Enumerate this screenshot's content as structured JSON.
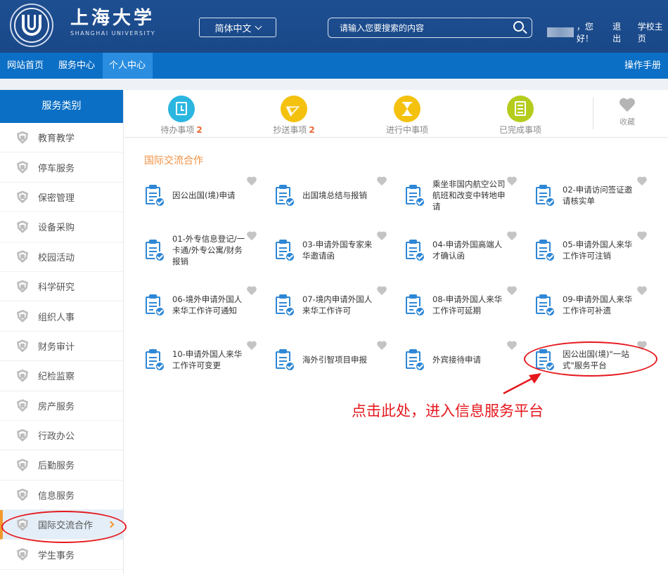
{
  "header": {
    "logo_cn": "上海大学",
    "logo_en": "SHANGHAI UNIVERSITY",
    "language": "简体中文",
    "search_placeholder": "请输入您要搜索的内容",
    "greeting": "，您好！",
    "logout": "退出",
    "school_home": "学校主页"
  },
  "nav": {
    "items": [
      "网站首页",
      "服务中心",
      "个人中心"
    ],
    "active": "个人中心",
    "manual": "操作手册"
  },
  "sidebar": {
    "title": "服务类别",
    "items": [
      "教育教学",
      "停车服务",
      "保密管理",
      "设备采购",
      "校园活动",
      "科学研究",
      "组织人事",
      "财务审计",
      "纪检监察",
      "房产服务",
      "行政办公",
      "后勤服务",
      "信息服务",
      "国际交流合作",
      "学生事务"
    ],
    "active": "国际交流合作"
  },
  "tabs": [
    {
      "label": "待办事项",
      "count": "2",
      "icon": "clock-calendar-icon",
      "color": "#2bb6e0"
    },
    {
      "label": "抄送事项",
      "count": "2",
      "icon": "paper-plane-icon",
      "color": "#f4c10f"
    },
    {
      "label": "进行中事项",
      "count": "",
      "icon": "hourglass-icon",
      "color": "#f4c10f"
    },
    {
      "label": "已完成事项",
      "count": "",
      "icon": "checklist-icon",
      "color": "#b6cc1d"
    }
  ],
  "favorites_label": "收藏",
  "section_title": "国际交流合作",
  "services": [
    "因公出国(境)申请",
    "出国境总结与报销",
    "乘坐非国内航空公司航班和改变中转地申请",
    "02-申请访问签证邀请核实单",
    "01-外专信息登记/一卡通/外专公寓/财务报销",
    "03-申请外国专家来华邀请函",
    "04-申请外国高端人才确认函",
    "05-申请外国人来华工作许可注销",
    "06-境外申请外国人来华工作许可通知",
    "07-境内申请外国人来华工作许可",
    "08-申请外国人来华工作许可延期",
    "09-申请外国人来华工作许可补遗",
    "10-申请外国人来华工作许可变更",
    "海外引智项目申报",
    "外宾接待申请",
    "因公出国(境)\"一站式\"服务平台"
  ],
  "annotation": "点击此处，进入信息服务平台",
  "colors": {
    "header": "#1d4f91",
    "nav": "#0b6fc6",
    "accent": "#f09244",
    "annotation": "#e5181e"
  }
}
